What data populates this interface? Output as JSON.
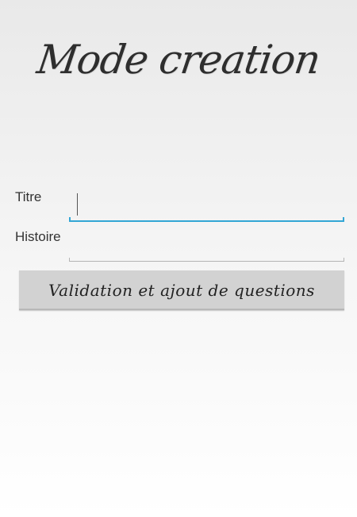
{
  "header": {
    "title": "Mode creation"
  },
  "form": {
    "titre_label": "Titre",
    "titre_value": "",
    "histoire_label": "Histoire",
    "histoire_value": "",
    "submit_label": "Validation et ajout de questions"
  },
  "colors": {
    "focus_accent": "#33a6d5",
    "button_background": "#d2d2d2"
  }
}
